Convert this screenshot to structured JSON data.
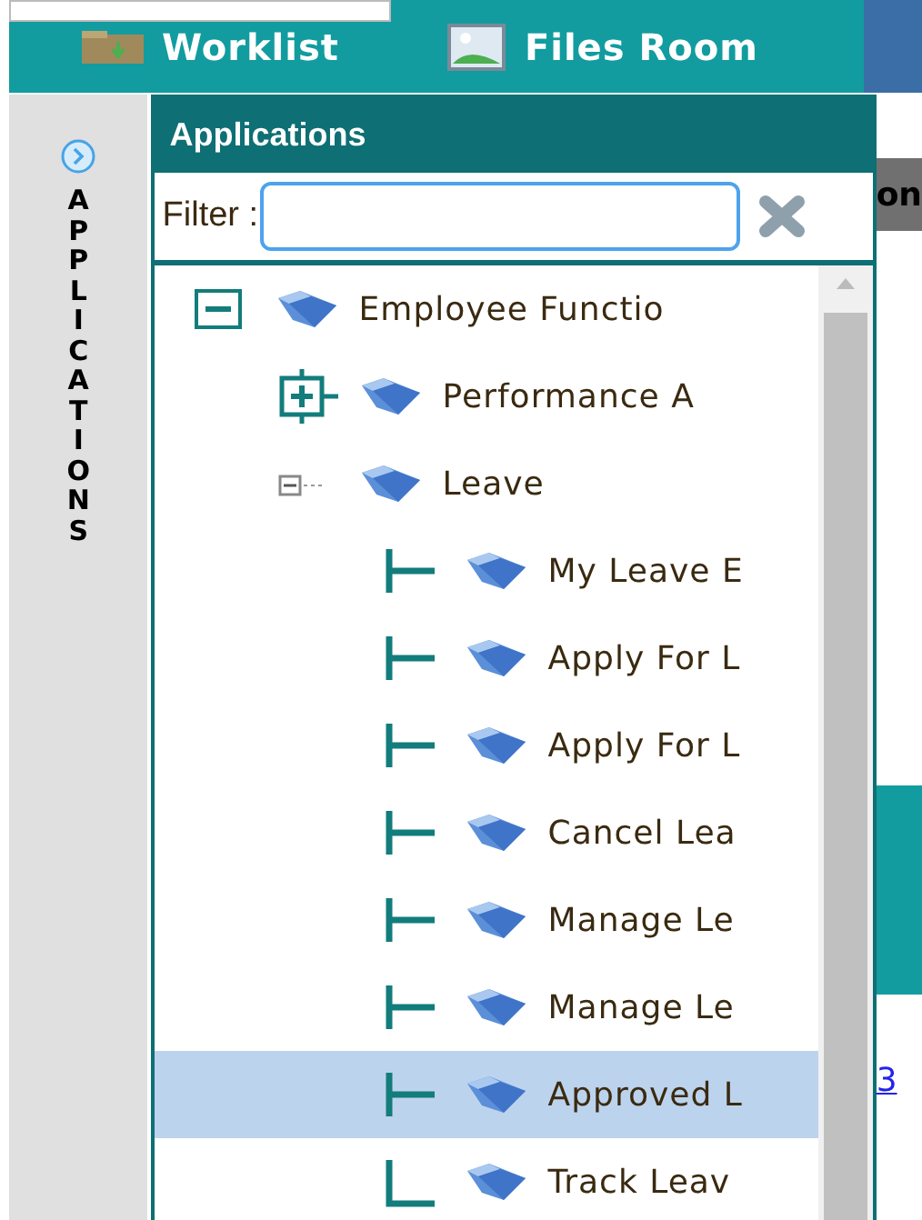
{
  "topbar": {
    "tabs": [
      {
        "label": "Worklist",
        "kind": "folder"
      },
      {
        "label": "Files Room",
        "kind": "image"
      }
    ]
  },
  "sidebar": {
    "label": "APPLICATIONS"
  },
  "panel": {
    "title": "Applications",
    "filter": {
      "label": "Filter :"
    },
    "tree": [
      {
        "label": "Employee Functio",
        "expanded": true,
        "selected": false,
        "children": [
          {
            "label": "Performance A",
            "expanded": false,
            "selected": false
          },
          {
            "label": "Leave",
            "expanded": true,
            "selected": false,
            "children": [
              {
                "label": "My Leave E",
                "selected": false
              },
              {
                "label": "Apply For L",
                "selected": false
              },
              {
                "label": "Apply For L",
                "selected": false
              },
              {
                "label": "Cancel Lea",
                "selected": false
              },
              {
                "label": "Manage Le",
                "selected": false
              },
              {
                "label": "Manage Le",
                "selected": false
              },
              {
                "label": "Approved L",
                "selected": true
              },
              {
                "label": "Track Leav",
                "selected": false
              }
            ]
          }
        ]
      }
    ]
  },
  "right": {
    "heading": "on",
    "link": "3"
  }
}
